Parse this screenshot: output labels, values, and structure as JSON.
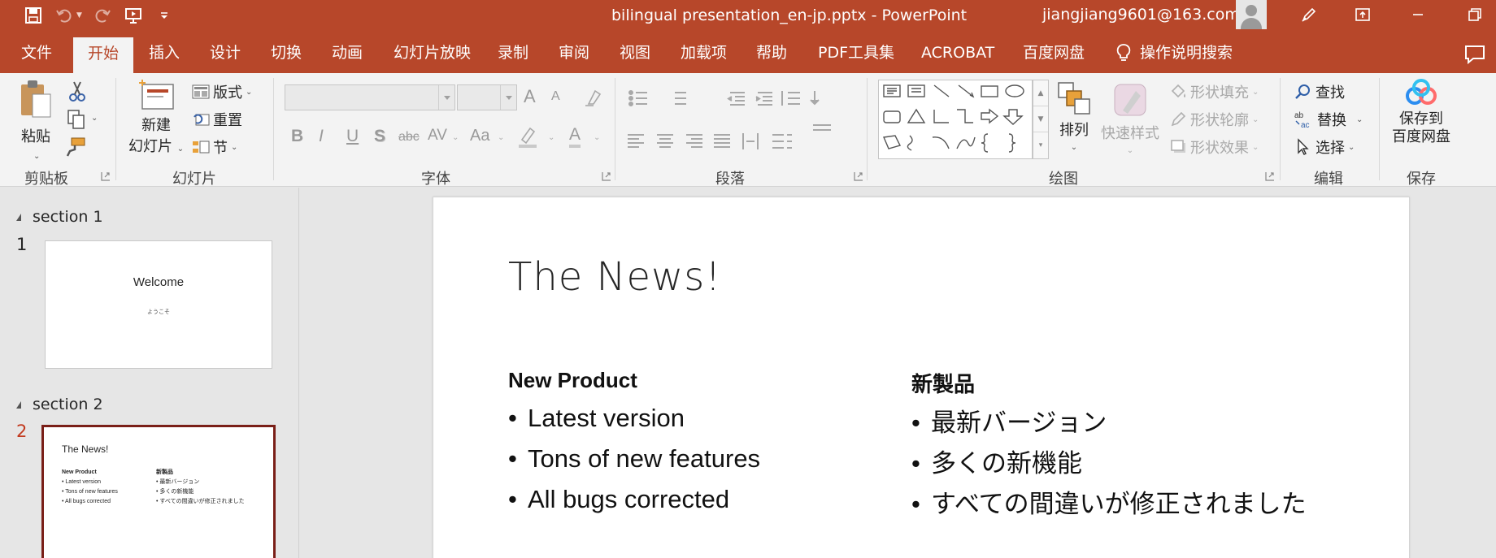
{
  "window": {
    "doc_title": "bilingual presentation_en-jp.pptx  -  PowerPoint",
    "user": "jiangjiang9601@163.com"
  },
  "qat": {
    "save_icon": "floppy-disk-icon",
    "undo_icon": "undo-icon",
    "redo_icon": "redo-icon",
    "present_icon": "present-from-beginning-icon",
    "customize_icon": "customize-qat-icon"
  },
  "tabs": [
    "文件",
    "开始",
    "插入",
    "设计",
    "切换",
    "动画",
    "幻灯片放映",
    "录制",
    "审阅",
    "视图",
    "加载项",
    "帮助",
    "PDF工具集",
    "ACROBAT",
    "百度网盘"
  ],
  "active_tab": "开始",
  "tell_me": "操作说明搜索",
  "ribbon": {
    "clipboard": {
      "paste": "粘贴",
      "label": "剪贴板"
    },
    "slides": {
      "new_slide_1": "新建",
      "new_slide_2": "幻灯片",
      "layout": "版式",
      "reset": "重置",
      "section": "节",
      "label": "幻灯片"
    },
    "font": {
      "label": "字体",
      "bold": "B",
      "italic": "I",
      "underline": "U",
      "shadow": "S",
      "strike": "abc",
      "spacing": "AV",
      "case": "Aa",
      "grow": "A",
      "shrink": "A",
      "color": "A"
    },
    "paragraph": {
      "label": "段落"
    },
    "drawing": {
      "arrange": "排列",
      "quick_styles": "快速样式",
      "fill": "形状填充",
      "outline": "形状轮廓",
      "effects": "形状效果",
      "label": "绘图"
    },
    "editing": {
      "find": "查找",
      "replace": "替换",
      "select": "选择",
      "label": "编辑"
    },
    "save": {
      "line1": "保存到",
      "line2": "百度网盘",
      "label": "保存"
    }
  },
  "thumbnails": {
    "sections": [
      "section 1",
      "section 2"
    ],
    "slides": [
      {
        "num": "1",
        "title": "Welcome",
        "subtitle": "ようこそ"
      },
      {
        "num": "2",
        "title": "The News!"
      }
    ]
  },
  "slide": {
    "title": "The News!",
    "left": {
      "header": "New Product",
      "bullets": [
        "Latest version",
        "Tons of new features",
        "All bugs corrected"
      ]
    },
    "right": {
      "header": "新製品",
      "bullets": [
        "最新バージョン",
        "多くの新機能",
        "すべての間違いが修正されました"
      ]
    }
  },
  "colors": {
    "accent": "#b7472a",
    "selected_thumb_border": "#7a1f18"
  }
}
